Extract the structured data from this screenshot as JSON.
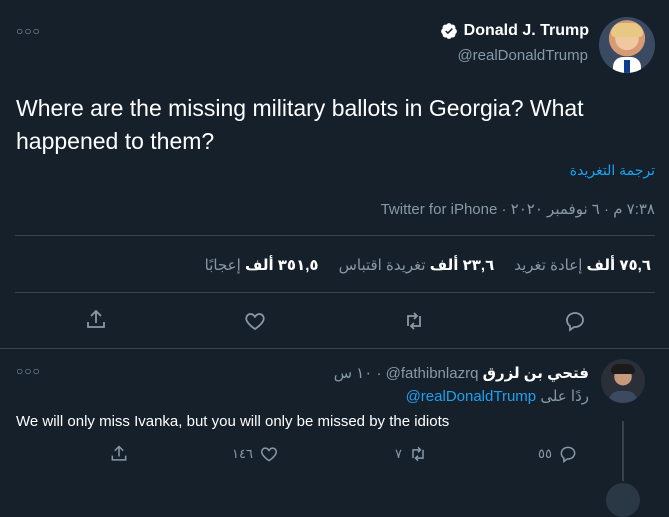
{
  "tweet": {
    "author_name": "Donald J. Trump",
    "author_handle": "@realDonaldTrump",
    "text": "Where are the missing military ballots in Georgia? What happened to them?",
    "translate_label": "ترجمة التغريدة",
    "timestamp": "٧:٣٨ م · ٦ نوفمبر ٢٠٢٠ · ",
    "source": "Twitter for iPhone",
    "stats": {
      "retweets_count": "٧٥,٦ ألف",
      "retweets_label": "إعادة تغريد",
      "quotes_count": "٢٣,٦ ألف",
      "quotes_label": "تغريدة اقتباس",
      "likes_count": "٣٥١,٥ ألف",
      "likes_label": "إعجابًا"
    }
  },
  "reply": {
    "author_name": "فتحي بن لزرق",
    "author_handle": "@fathibnlazrq",
    "time": "١٠ س",
    "replying_prefix": "ردًا على",
    "replying_to": "@realDonaldTrump",
    "text": "We will only miss Ivanka, but you will only be missed by the idiots",
    "reply_count": "٥٥",
    "retweet_count": "٧",
    "like_count": "١٤٦"
  },
  "icons": {
    "more": "more-icon",
    "verified": "verified-badge-icon",
    "reply": "reply-icon",
    "retweet": "retweet-icon",
    "like": "like-icon",
    "share": "share-icon"
  },
  "colors": {
    "background": "#15202b",
    "text": "#ffffff",
    "muted": "#8899a6",
    "link": "#1da1f2",
    "divider": "#38444d"
  }
}
